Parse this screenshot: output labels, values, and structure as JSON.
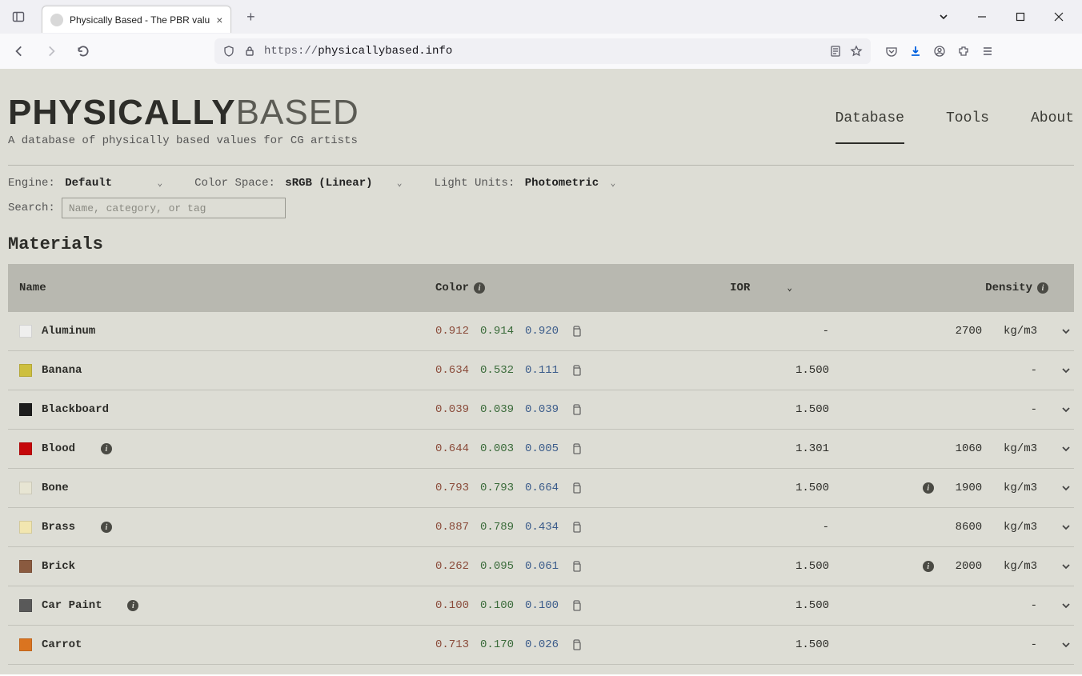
{
  "browser": {
    "tab_title": "Physically Based - The PBR valu",
    "url_display_prefix": "https://",
    "url_display_domain": "physicallybased.info"
  },
  "brand": {
    "title_bold": "PHYSICALLY",
    "title_light": "BASED",
    "tagline": "A database of physically based values for CG artists"
  },
  "nav": {
    "database": "Database",
    "tools": "Tools",
    "about": "About"
  },
  "filters": {
    "engine_label": "Engine:",
    "engine_value": "Default",
    "colorspace_label": "Color Space:",
    "colorspace_value": "sRGB (Linear)",
    "light_label": "Light Units:",
    "light_value": "Photometric"
  },
  "search": {
    "label": "Search:",
    "placeholder": "Name, category, or tag"
  },
  "section_title": "Materials",
  "columns": {
    "name": "Name",
    "color": "Color",
    "ior": "IOR",
    "density": "Density"
  },
  "density_unit": "kg/m3",
  "materials": [
    {
      "name": "Aluminum",
      "swatch": "#efefee",
      "r": "0.912",
      "g": "0.914",
      "b": "0.920",
      "ior": "-",
      "density": "2700",
      "name_info": false,
      "dens_info": false
    },
    {
      "name": "Banana",
      "swatch": "#cdbf3f",
      "r": "0.634",
      "g": "0.532",
      "b": "0.111",
      "ior": "1.500",
      "density": "-",
      "name_info": false,
      "dens_info": false
    },
    {
      "name": "Blackboard",
      "swatch": "#1c1c1c",
      "r": "0.039",
      "g": "0.039",
      "b": "0.039",
      "ior": "1.500",
      "density": "-",
      "name_info": false,
      "dens_info": false
    },
    {
      "name": "Blood",
      "swatch": "#c5070a",
      "r": "0.644",
      "g": "0.003",
      "b": "0.005",
      "ior": "1.301",
      "density": "1060",
      "name_info": true,
      "dens_info": false
    },
    {
      "name": "Bone",
      "swatch": "#e7e5d3",
      "r": "0.793",
      "g": "0.793",
      "b": "0.664",
      "ior": "1.500",
      "density": "1900",
      "name_info": false,
      "dens_info": true
    },
    {
      "name": "Brass",
      "swatch": "#f2e6b0",
      "r": "0.887",
      "g": "0.789",
      "b": "0.434",
      "ior": "-",
      "density": "8600",
      "name_info": true,
      "dens_info": false
    },
    {
      "name": "Brick",
      "swatch": "#8a5a3f",
      "r": "0.262",
      "g": "0.095",
      "b": "0.061",
      "ior": "1.500",
      "density": "2000",
      "name_info": false,
      "dens_info": true
    },
    {
      "name": "Car Paint",
      "swatch": "#595959",
      "r": "0.100",
      "g": "0.100",
      "b": "0.100",
      "ior": "1.500",
      "density": "-",
      "name_info": true,
      "dens_info": false
    },
    {
      "name": "Carrot",
      "swatch": "#da7420",
      "r": "0.713",
      "g": "0.170",
      "b": "0.026",
      "ior": "1.500",
      "density": "-",
      "name_info": false,
      "dens_info": false
    }
  ]
}
